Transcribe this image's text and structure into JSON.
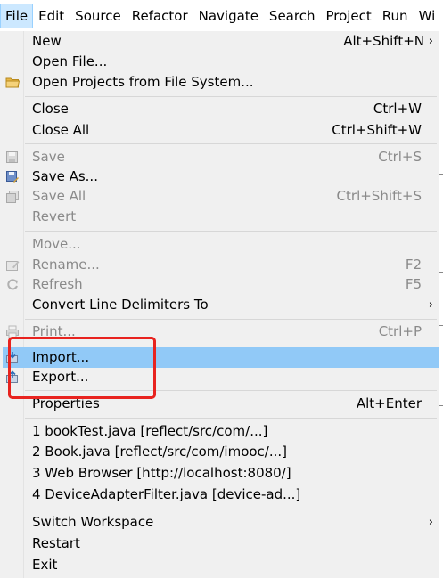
{
  "menubar": {
    "items": [
      {
        "label": "File",
        "active": true
      },
      {
        "label": "Edit"
      },
      {
        "label": "Source"
      },
      {
        "label": "Refactor"
      },
      {
        "label": "Navigate"
      },
      {
        "label": "Search"
      },
      {
        "label": "Project"
      },
      {
        "label": "Run"
      },
      {
        "label": "Wi"
      }
    ]
  },
  "menu": {
    "new": {
      "label": "New",
      "accel": "Alt+Shift+N",
      "arrow": "›"
    },
    "open_file": {
      "label": "Open File..."
    },
    "open_projects": {
      "label": "Open Projects from File System...",
      "icon": "folder-icon"
    },
    "close": {
      "label": "Close",
      "accel": "Ctrl+W"
    },
    "close_all": {
      "label": "Close All",
      "accel": "Ctrl+Shift+W"
    },
    "save": {
      "label": "Save",
      "accel": "Ctrl+S",
      "icon": "save-icon"
    },
    "save_as": {
      "label": "Save As...",
      "icon": "save-as-icon"
    },
    "save_all": {
      "label": "Save All",
      "accel": "Ctrl+Shift+S",
      "icon": "save-all-icon"
    },
    "revert": {
      "label": "Revert"
    },
    "move": {
      "label": "Move..."
    },
    "rename": {
      "label": "Rename...",
      "accel": "F2",
      "icon": "rename-icon"
    },
    "refresh": {
      "label": "Refresh",
      "accel": "F5",
      "icon": "refresh-icon"
    },
    "convert": {
      "label": "Convert Line Delimiters To",
      "arrow": "›"
    },
    "print": {
      "label": "Print...",
      "accel": "Ctrl+P",
      "icon": "print-icon"
    },
    "import": {
      "label": "Import...",
      "icon": "import-icon"
    },
    "export": {
      "label": "Export...",
      "icon": "export-icon"
    },
    "properties": {
      "label": "Properties",
      "accel": "Alt+Enter"
    },
    "recent1": {
      "label": "1 bookTest.java  [reflect/src/com/...]"
    },
    "recent2": {
      "label": "2 Book.java  [reflect/src/com/imooc/...]"
    },
    "recent3": {
      "label": "3 Web Browser  [http://localhost:8080/]"
    },
    "recent4": {
      "label": "4 DeviceAdapterFilter.java  [device-ad...]"
    },
    "switch_workspace": {
      "label": "Switch Workspace",
      "arrow": "›"
    },
    "restart": {
      "label": "Restart"
    },
    "exit": {
      "label": "Exit"
    }
  },
  "colors": {
    "highlight": "#91c9f7",
    "annotation": "#e8231f",
    "disabled_text": "#8a8a8a"
  }
}
